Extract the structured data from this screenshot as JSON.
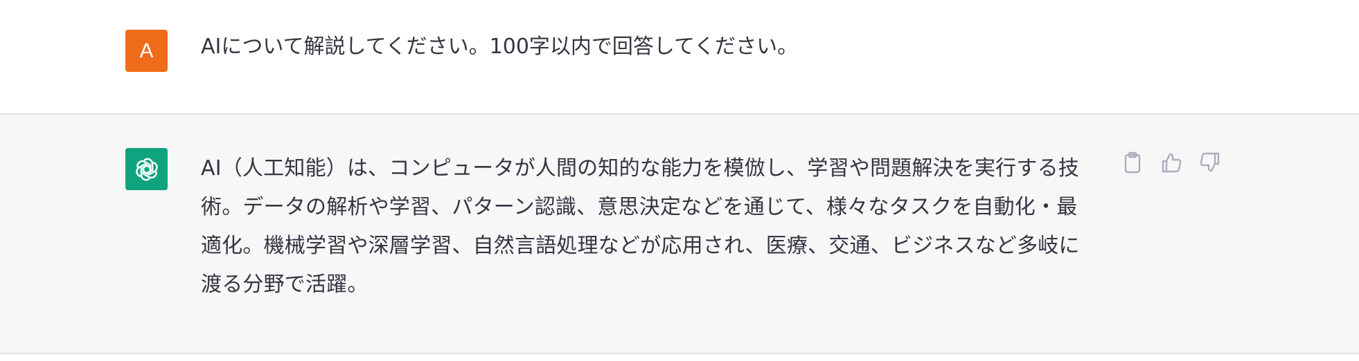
{
  "colors": {
    "user_avatar_bg": "#ef6c1a",
    "bot_avatar_bg": "#10a37f",
    "icon_color": "#acacbe"
  },
  "user": {
    "avatar_letter": "A",
    "message": "AIについて解説してください。100字以内で回答してください。"
  },
  "assistant": {
    "avatar_icon": "openai-logo-icon",
    "message": "AI（人工知能）は、コンピュータが人間の知的な能力を模倣し、学習や問題解決を実行する技術。データの解析や学習、パターン認識、意思決定などを通じて、様々なタスクを自動化・最適化。機械学習や深層学習、自然言語処理などが応用され、医療、交通、ビジネスなど多岐に渡る分野で活躍。",
    "actions": [
      {
        "icon": "clipboard-icon"
      },
      {
        "icon": "thumbs-up-icon"
      },
      {
        "icon": "thumbs-down-icon"
      }
    ]
  }
}
